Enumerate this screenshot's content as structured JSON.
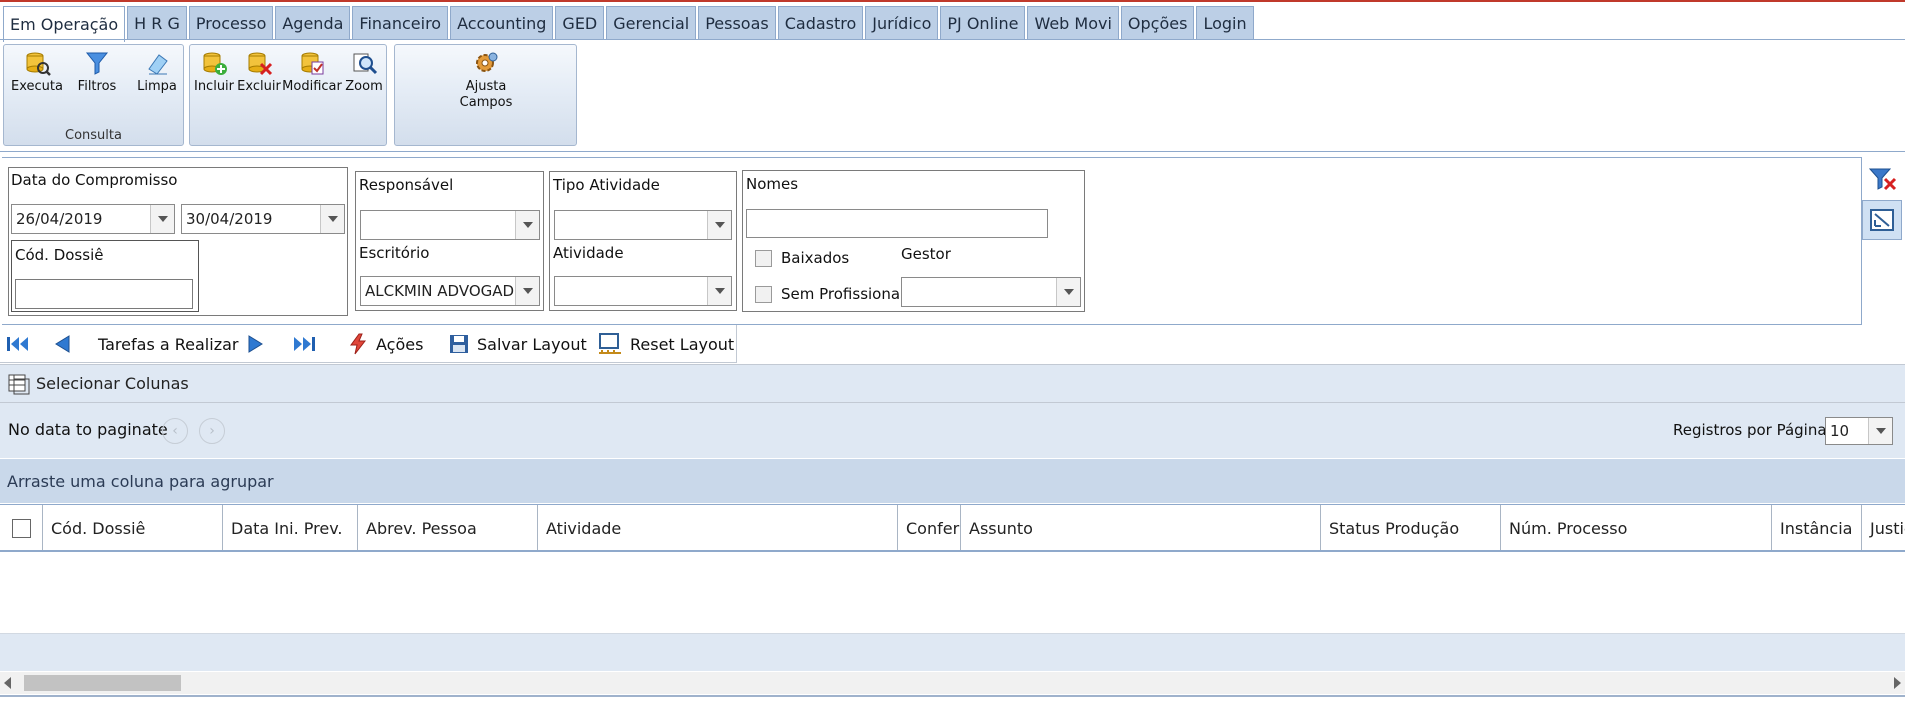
{
  "tabs": [
    "Em Operação",
    "H R G",
    "Processo",
    "Agenda",
    "Financeiro",
    "Accounting",
    "GED",
    "Gerencial",
    "Pessoas",
    "Cadastro",
    "Jurídico",
    "PJ Online",
    "Web Movi",
    "Opções",
    "Login"
  ],
  "ribbon": {
    "consulta": {
      "execute": "Executa",
      "filters": "Filtros",
      "clear": "Limpa",
      "group_label": "Consulta"
    },
    "edit": {
      "include": "Incluir",
      "delete": "Excluir",
      "modify": "Modificar",
      "zoom": "Zoom"
    },
    "fields": {
      "adjust_line1": "Ajusta",
      "adjust_line2": "Campos"
    }
  },
  "filters": {
    "date_label": "Data do Compromisso",
    "date_from": "26/04/2019",
    "date_to": "30/04/2019",
    "dossie_label": "Cód. Dossiê",
    "dossie_value": "",
    "responsavel_label": "Responsável",
    "responsavel_value": "",
    "escritorio_label": "Escritório",
    "escritorio_value": "ALCKMIN ADVOGAD(",
    "tipo_label": "Tipo Atividade",
    "tipo_value": "",
    "atividade_label": "Atividade",
    "atividade_value": "",
    "nomes_label": "Nomes",
    "nomes_value": "",
    "baixados_label": "Baixados",
    "sem_prof_label": "Sem Profissional",
    "gestor_label": "Gestor",
    "gestor_value": ""
  },
  "navbar": {
    "tasks_label": "Tarefas a Realizar",
    "actions_label": "Ações",
    "save_layout": "Salvar Layout",
    "reset_layout": "Reset Layout"
  },
  "grid": {
    "select_columns": "Selecionar Colunas",
    "no_data": "No data to paginate",
    "per_page_label": "Registros por Página",
    "per_page_value": "10",
    "group_hint": "Arraste uma coluna para agrupar",
    "columns": [
      "Cód. Dossiê",
      "Data Ini. Prev.",
      "Abrev. Pessoa",
      "Atividade",
      "Conferi",
      "Assunto",
      "Status Produção",
      "Núm. Processo",
      "Instância",
      "Justiç"
    ]
  }
}
